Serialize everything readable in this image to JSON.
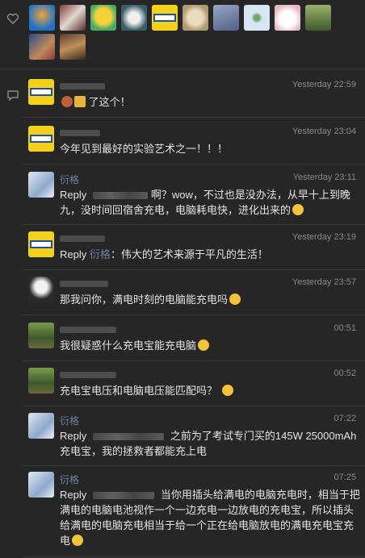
{
  "likes": {
    "avatar_colors": [
      "#1e73c9",
      "#8a3a3a",
      "#e8c232",
      "#3a5d6a",
      "#1b4fb0",
      "#c9b48a",
      "#6f7fa0",
      "#a9c3d6",
      "#e6e6e6",
      "#5e7a3e",
      "#b0603a",
      "#7a5a3a"
    ]
  },
  "comments": [
    {
      "avatar": "brand-logo",
      "name": "",
      "time": "Yesterday 22:59",
      "text": "了这个！",
      "emojis": [
        "ox-emoji",
        "beer-emoji"
      ]
    },
    {
      "avatar": "brand-logo",
      "name": "",
      "time": "Yesterday 23:04",
      "text": "今年见到最好的实验艺术之一！！！"
    },
    {
      "avatar": "paper-avatar",
      "name": "衍格",
      "time": "Yesterday 23:11",
      "reply_label": "Reply",
      "text": "啊？wow，不过也是没办法，从早十上到晚九，没时间回宿舍充电，电脑耗电快，进化出来的"
    },
    {
      "avatar": "brand-logo",
      "name": "",
      "time": "Yesterday 23:19",
      "reply_label": "Reply",
      "reply_to": "衍格",
      "text": "：伟大的艺术来源于平凡的生活！"
    },
    {
      "avatar": "sketch-avatar",
      "name": "",
      "time": "Yesterday 23:57",
      "text": "那我问你，满电时刻的电脑能充电吗"
    },
    {
      "avatar": "tree-avatar",
      "name": "",
      "time": "00:51",
      "text": "我很疑惑什么充电宝能充电脑"
    },
    {
      "avatar": "tree-avatar",
      "name": "",
      "time": "00:52",
      "text": "充电宝电压和电脑电压能匹配吗？"
    },
    {
      "avatar": "paper-avatar",
      "name": "衍格",
      "time": "07:22",
      "reply_label": "Reply",
      "text": "之前为了考试专门买的145W 25000mAh充电宝，我的拯救者都能充上电"
    },
    {
      "avatar": "paper-avatar",
      "name": "衍格",
      "time": "07:25",
      "reply_label": "Reply",
      "text": "当你用插头给满电的电脑充电时，相当于把满电的电脑电池视作一个一边充电一边放电的充电宝，所以插头给满电的电脑充电相当于给一个正在给电脑放电的满电充电宝充电"
    }
  ]
}
